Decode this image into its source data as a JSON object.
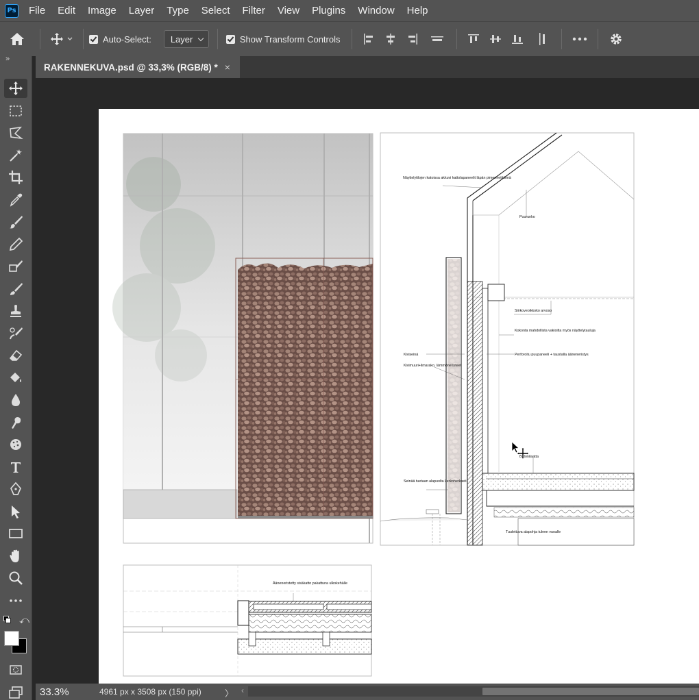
{
  "menu": {
    "logo": "Ps",
    "items": [
      "File",
      "Edit",
      "Image",
      "Layer",
      "Type",
      "Select",
      "Filter",
      "View",
      "Plugins",
      "Window",
      "Help"
    ]
  },
  "options": {
    "auto_select_label": "Auto-Select:",
    "auto_select_target": "Layer",
    "show_transform_label": "Show Transform Controls"
  },
  "document_tab": {
    "title": "RAKENNEKUVA.psd @ 33,3% (RGB/8) *",
    "close": "×"
  },
  "status": {
    "zoom": "33.3%",
    "doc_info": "4961 px x 3508 px (150 ppi)"
  },
  "drawing_labels": {
    "panel_note": "Näyttelytilojen katoissa akkuvi kattolapaneelit läpän pimennetttiinnä",
    "puurunko": "Puurunko",
    "sirkoveo": "Siirkoveoikkoko arvoso",
    "kokonta": "Kokonta mahdollista vakioilta myös näyttelytauluja",
    "kiviseinä": "Kiviseinä",
    "kivimuuri": "Kivimuuri+ilmarako, lämmöneristeet",
    "perforoitu": "Perforoitu puupaneeli + taustalla ääneneristys",
    "lattia": "Betonilaatta",
    "seinaan": "Seinää tuetaan alapuolta kerkoherkasti",
    "tuuletettu": "Tuulettuva alapohja tuleen vuoalle",
    "detail_note": "Ääneneristetty sisäkatto pakattuna ulkokehälle"
  }
}
